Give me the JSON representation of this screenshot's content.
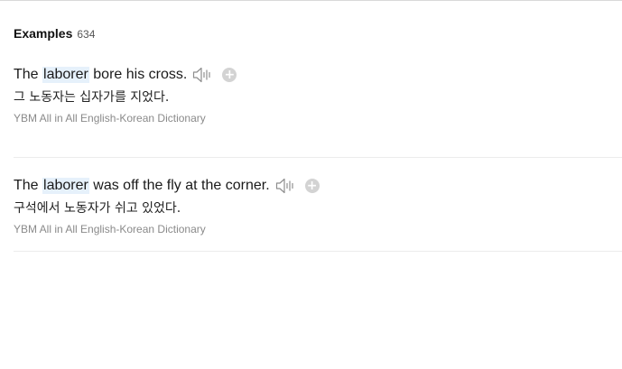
{
  "section": {
    "title": "Examples",
    "count": "634"
  },
  "examples": [
    {
      "before": "The ",
      "keyword": "laborer",
      "after": " bore his cross.",
      "translation": "그 노동자는 십자가를 지었다.",
      "source": "YBM All in All English-Korean Dictionary"
    },
    {
      "before": "The ",
      "keyword": "laborer",
      "after": " was off the fly at the corner.",
      "translation": "구석에서 노동자가 쉬고 있었다.",
      "source": "YBM All in All English-Korean Dictionary"
    }
  ],
  "icons": {
    "play": "speaker-icon",
    "add": "add-circle-icon"
  },
  "colors": {
    "highlight": "#e6f1fb",
    "add_button": "#d3d3d3",
    "source_text": "#8a8a8a"
  }
}
